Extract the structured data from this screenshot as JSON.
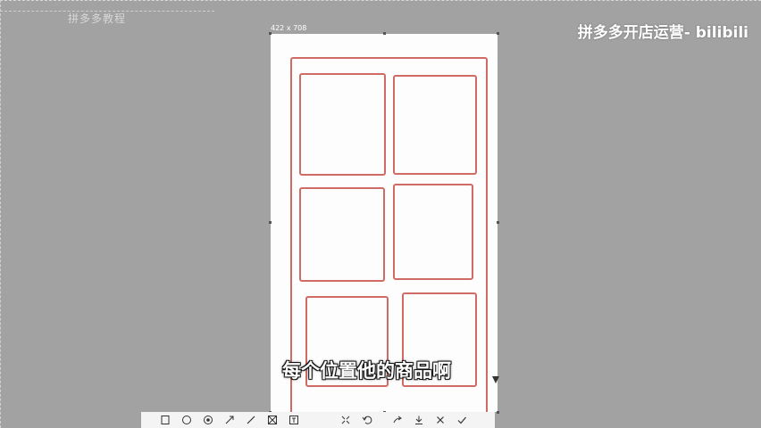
{
  "app": {
    "top_left_label": "拼多多教程",
    "watermark": "拼多多开店运营- bilibili"
  },
  "canvas": {
    "size_label": "422 x 708",
    "frame_color": "#cf6a65"
  },
  "subtitle": "每个位置他的商品啊",
  "toolbar": {
    "tools": [
      {
        "name": "rectangle-tool",
        "icon": "rectangle-icon"
      },
      {
        "name": "ellipse-tool",
        "icon": "circle-icon"
      },
      {
        "name": "marker-tool",
        "icon": "marker-icon"
      },
      {
        "name": "arrow-tool",
        "icon": "arrow-icon"
      },
      {
        "name": "pen-tool",
        "icon": "pen-icon"
      },
      {
        "name": "mosaic-tool",
        "icon": "mosaic-icon"
      },
      {
        "name": "text-tool",
        "icon": "text-icon"
      },
      {
        "name": "pin-tool",
        "icon": "pin-icon"
      },
      {
        "name": "undo-tool",
        "icon": "undo-icon"
      },
      {
        "name": "share-tool",
        "icon": "share-icon"
      },
      {
        "name": "save-tool",
        "icon": "save-icon"
      },
      {
        "name": "close-tool",
        "icon": "close-icon"
      },
      {
        "name": "confirm-tool",
        "icon": "check-icon"
      }
    ]
  }
}
